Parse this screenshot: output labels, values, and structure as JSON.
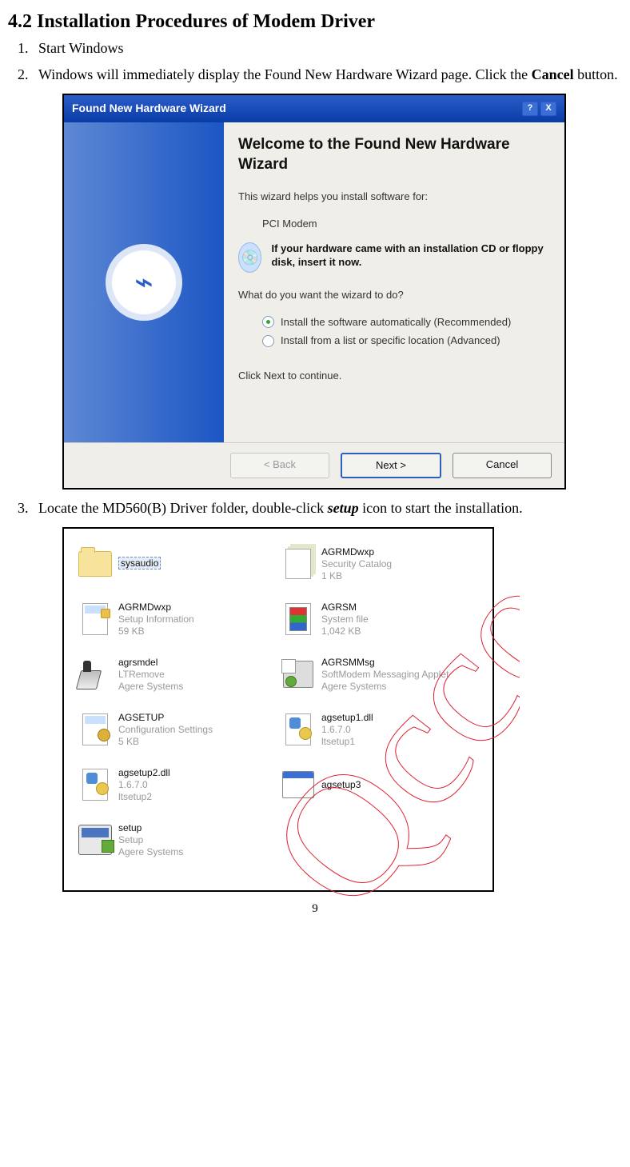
{
  "doc": {
    "heading": "4.2 Installation Procedures of Modem Driver",
    "steps": [
      {
        "num": "1.",
        "text_parts": [
          "Start Windows"
        ]
      },
      {
        "num": "2.",
        "text_parts": [
          "Windows will immediately display the Found New Hardware Wizard page. Click the ",
          "Cancel",
          " button."
        ]
      },
      {
        "num": "3.",
        "text_parts": [
          "Locate the MD560(B) Driver folder, double-click ",
          "setup",
          " icon to start the installation."
        ]
      }
    ],
    "page_number": "9"
  },
  "wizard": {
    "title": "Found New Hardware Wizard",
    "heading": "Welcome to the Found New Hardware Wizard",
    "intro": "This wizard helps you install software for:",
    "device": "PCI Modem",
    "cd_text": "If your hardware came with an installation CD or floppy disk, insert it now.",
    "prompt": "What do you want the wizard to do?",
    "opt1": "Install the software automatically (Recommended)",
    "opt2": "Install from a list or specific location (Advanced)",
    "continue": "Click Next to continue.",
    "buttons": {
      "back": "< Back",
      "next": "Next >",
      "cancel": "Cancel"
    },
    "sys": {
      "help": "?",
      "close": "X"
    }
  },
  "folder": {
    "items": [
      {
        "name": "sysaudio",
        "desc": "",
        "desc2": "",
        "icon": "folder",
        "select": true
      },
      {
        "name": "AGRMDwxp",
        "desc": "Security Catalog",
        "desc2": "1 KB",
        "icon": "cat"
      },
      {
        "name": "AGRMDwxp",
        "desc": "Setup Information",
        "desc2": "59 KB",
        "icon": "inf"
      },
      {
        "name": "AGRSM",
        "desc": "System file",
        "desc2": "1,042 KB",
        "icon": "sys"
      },
      {
        "name": "agrsmdel",
        "desc": "LTRemove",
        "desc2": "Agere Systems",
        "icon": "exe-ltr"
      },
      {
        "name": "AGRSMMsg",
        "desc": "SoftModem Messaging Applet",
        "desc2": "Agere Systems",
        "icon": "app"
      },
      {
        "name": "AGSETUP",
        "desc": "Configuration Settings",
        "desc2": "5 KB",
        "icon": "cfg"
      },
      {
        "name": "agsetup1.dll",
        "desc": "1.6.7.0",
        "desc2": "ltsetup1",
        "icon": "dll"
      },
      {
        "name": "agsetup2.dll",
        "desc": "1.6.7.0",
        "desc2": "ltsetup2",
        "icon": "dll"
      },
      {
        "name": "agsetup3",
        "desc": "",
        "desc2": "",
        "icon": "win"
      },
      {
        "name": "setup",
        "desc": "Setup",
        "desc2": "Agere Systems",
        "icon": "setup"
      }
    ]
  },
  "watermark": {
    "text": "Qccom"
  }
}
